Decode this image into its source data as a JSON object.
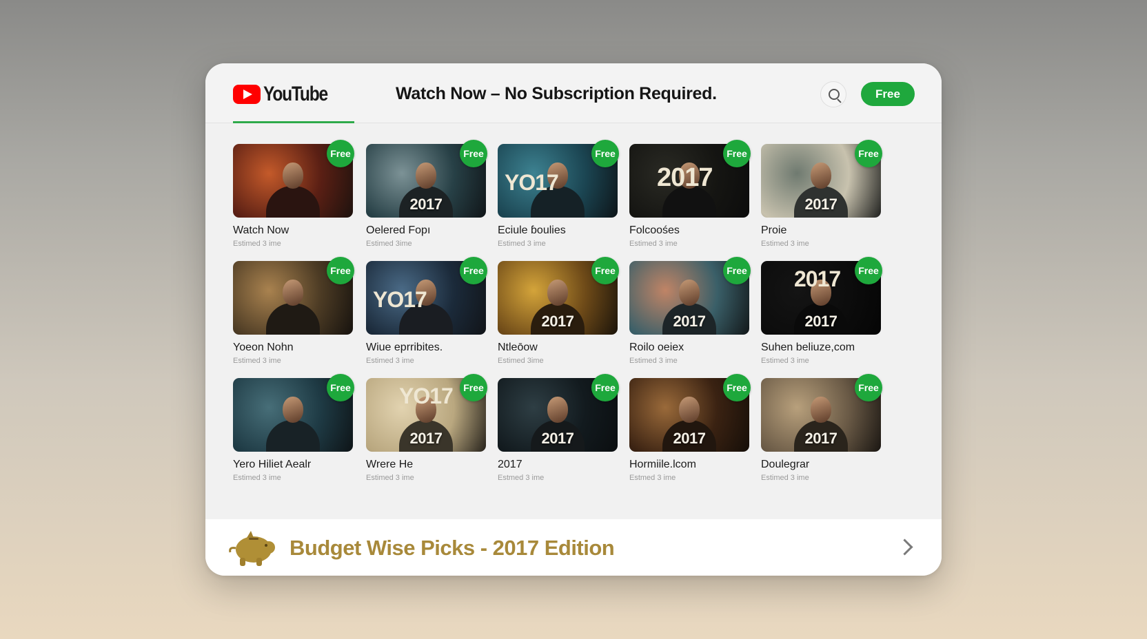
{
  "header": {
    "logo_text": "YouTube",
    "headline": "Watch Now – No Subscription Required.",
    "free_button": "Free",
    "search_icon": "search-icon"
  },
  "colors": {
    "brand_red": "#ff0000",
    "free_green": "#1fa83d",
    "tab_underline": "#2eaa4a",
    "footer_gold": "#a8893a"
  },
  "videos": [
    {
      "title": "Watch Now",
      "subtitle": "Estimed 3 ime",
      "badge": "Free",
      "poster_text": "",
      "year": ""
    },
    {
      "title": "Oelered Fopı",
      "subtitle": "Estimed 3ime",
      "badge": "Free",
      "poster_text": "",
      "year": "2017"
    },
    {
      "title": "Eciule ɓoulies",
      "subtitle": "Estimed 3 ime",
      "badge": "Free",
      "poster_text": "YO17",
      "year": ""
    },
    {
      "title": "Folcoośes",
      "subtitle": "Estimed 3 ime",
      "badge": "Free",
      "poster_text": "2017",
      "year": ""
    },
    {
      "title": "Proie",
      "subtitle": "Estimed 3 ime",
      "badge": "Free",
      "poster_text": "",
      "year": "2017"
    },
    {
      "title": "Yoeon Nohn",
      "subtitle": "Estimed 3 ime",
      "badge": "Free",
      "poster_text": "",
      "year": ""
    },
    {
      "title": "Wiue eprribites.",
      "subtitle": "Estimed 3 ime",
      "badge": "Free",
      "poster_text": "YO17",
      "year": ""
    },
    {
      "title": "Ntleōow",
      "subtitle": "Estimed 3ime",
      "badge": "Free",
      "poster_text": "",
      "year": "2017"
    },
    {
      "title": "Roilo oeiex",
      "subtitle": "Estimed 3 ime",
      "badge": "Free",
      "poster_text": "",
      "year": "2017"
    },
    {
      "title": "Suhen beliuze,com",
      "subtitle": "Estimed 3 ime",
      "badge": "Free",
      "poster_text": "2017",
      "year": "2017"
    },
    {
      "title": "Yero Hiliet Aealr",
      "subtitle": "Estimed 3 ime",
      "badge": "Free",
      "poster_text": "",
      "year": ""
    },
    {
      "title": "Wrere He",
      "subtitle": "Estimed 3 ime",
      "badge": "Free",
      "poster_text": "YO17",
      "year": "2017"
    },
    {
      "title": "2017",
      "subtitle": "Estmed 3 ime",
      "badge": "Free",
      "poster_text": "",
      "year": "2017"
    },
    {
      "title": "Hormiile.lcom",
      "subtitle": "Estmed 3 ime",
      "badge": "Free",
      "poster_text": "",
      "year": "2017"
    },
    {
      "title": "Douleɡrar",
      "subtitle": "Estimed 3 ime",
      "badge": "Free",
      "poster_text": "",
      "year": "2017"
    }
  ],
  "footer": {
    "label": "Budget Wise Picks - 2017 Edition",
    "icon": "piggy-bank-icon",
    "chevron": "chevron-right-icon"
  }
}
